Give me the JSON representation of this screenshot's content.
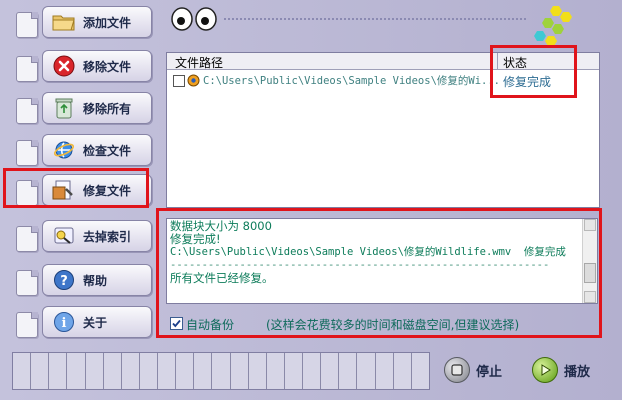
{
  "sidebar": {
    "items": [
      {
        "label": "添加文件",
        "icon": "folder-open-icon"
      },
      {
        "label": "移除文件",
        "icon": "remove-red-x-icon"
      },
      {
        "label": "移除所有",
        "icon": "recycle-bin-icon"
      },
      {
        "label": "检查文件",
        "icon": "internet-explorer-icon"
      },
      {
        "label": "修复文件",
        "icon": "repair-file-icon",
        "selected": true
      },
      {
        "label": "去掉索引",
        "icon": "remove-index-icon"
      },
      {
        "label": "帮助",
        "icon": "help-question-icon"
      },
      {
        "label": "关于",
        "icon": "info-icon"
      }
    ]
  },
  "file_list": {
    "columns": [
      "文件路径",
      "状态"
    ],
    "rows": [
      {
        "path": "C:\\Users\\Public\\Videos\\Sample Videos\\修复的Wi...",
        "status": "修复完成"
      }
    ]
  },
  "log": {
    "lines": [
      "数据块大小为 8000",
      "修复完成!",
      "C:\\Users\\Public\\Videos\\Sample Videos\\修复的Wildlife.wmv  修复完成",
      "------------------------------------------------------------",
      "所有文件已经修复。"
    ]
  },
  "backup": {
    "checked": true,
    "label": "自动备份",
    "hint": "(这样会花费较多的时间和磁盘空间,但建议选择)"
  },
  "controls": {
    "stop_label": "停止",
    "play_label": "播放"
  },
  "colors": {
    "highlight_outline": "#e0141b",
    "log_text": "#0d7c5a",
    "status_text": "#2e6d93",
    "hex_yellow": "#f2df1a",
    "hex_green": "#9fd23b",
    "hex_cyan": "#3ec9d4"
  }
}
